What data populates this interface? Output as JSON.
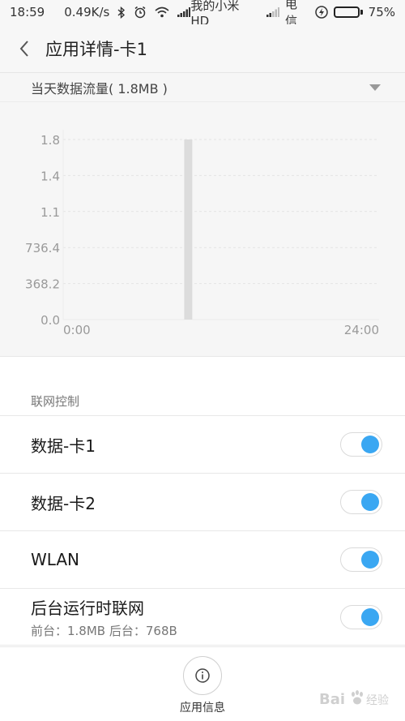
{
  "status_bar": {
    "time": "18:59",
    "speed": "0.49K/s",
    "carrier1": "我的小米 HD",
    "carrier2": "电信",
    "battery": "75%",
    "battery_level": 0.75
  },
  "header": {
    "title": "应用详情-卡1"
  },
  "traffic": {
    "selector_label": "当天数据流量( 1.8MB )"
  },
  "chart_data": {
    "type": "bar",
    "y_ticks": [
      "1.8",
      "1.4",
      "1.1",
      "736.4",
      "368.2",
      "0.0"
    ],
    "x_ticks": [
      "0:00",
      "24:00"
    ],
    "ylim": [
      0,
      1.8
    ],
    "xlim": [
      0,
      24
    ],
    "bars": [
      {
        "x": 9.5,
        "value": 1.8
      }
    ],
    "grid": true,
    "colors": {
      "bar": "#dcdcdc",
      "grid": "#e4e4e4",
      "axis": "#ececec",
      "tick": "#9a9a9a"
    }
  },
  "network_control": {
    "header": "联网控制",
    "items": [
      {
        "label": "数据-卡1",
        "sub": "",
        "enabled": true
      },
      {
        "label": "数据-卡2",
        "sub": "",
        "enabled": true
      },
      {
        "label": "WLAN",
        "sub": "",
        "enabled": true
      },
      {
        "label": "后台运行时联网",
        "sub": "前台：1.8MB  后台：768B",
        "enabled": true
      }
    ]
  },
  "bottom": {
    "info_label": "应用信息"
  },
  "watermark": {
    "text": "Baidu经验"
  },
  "colors": {
    "accent": "#3aa7f2",
    "battery_fill": "#3ac93a"
  }
}
